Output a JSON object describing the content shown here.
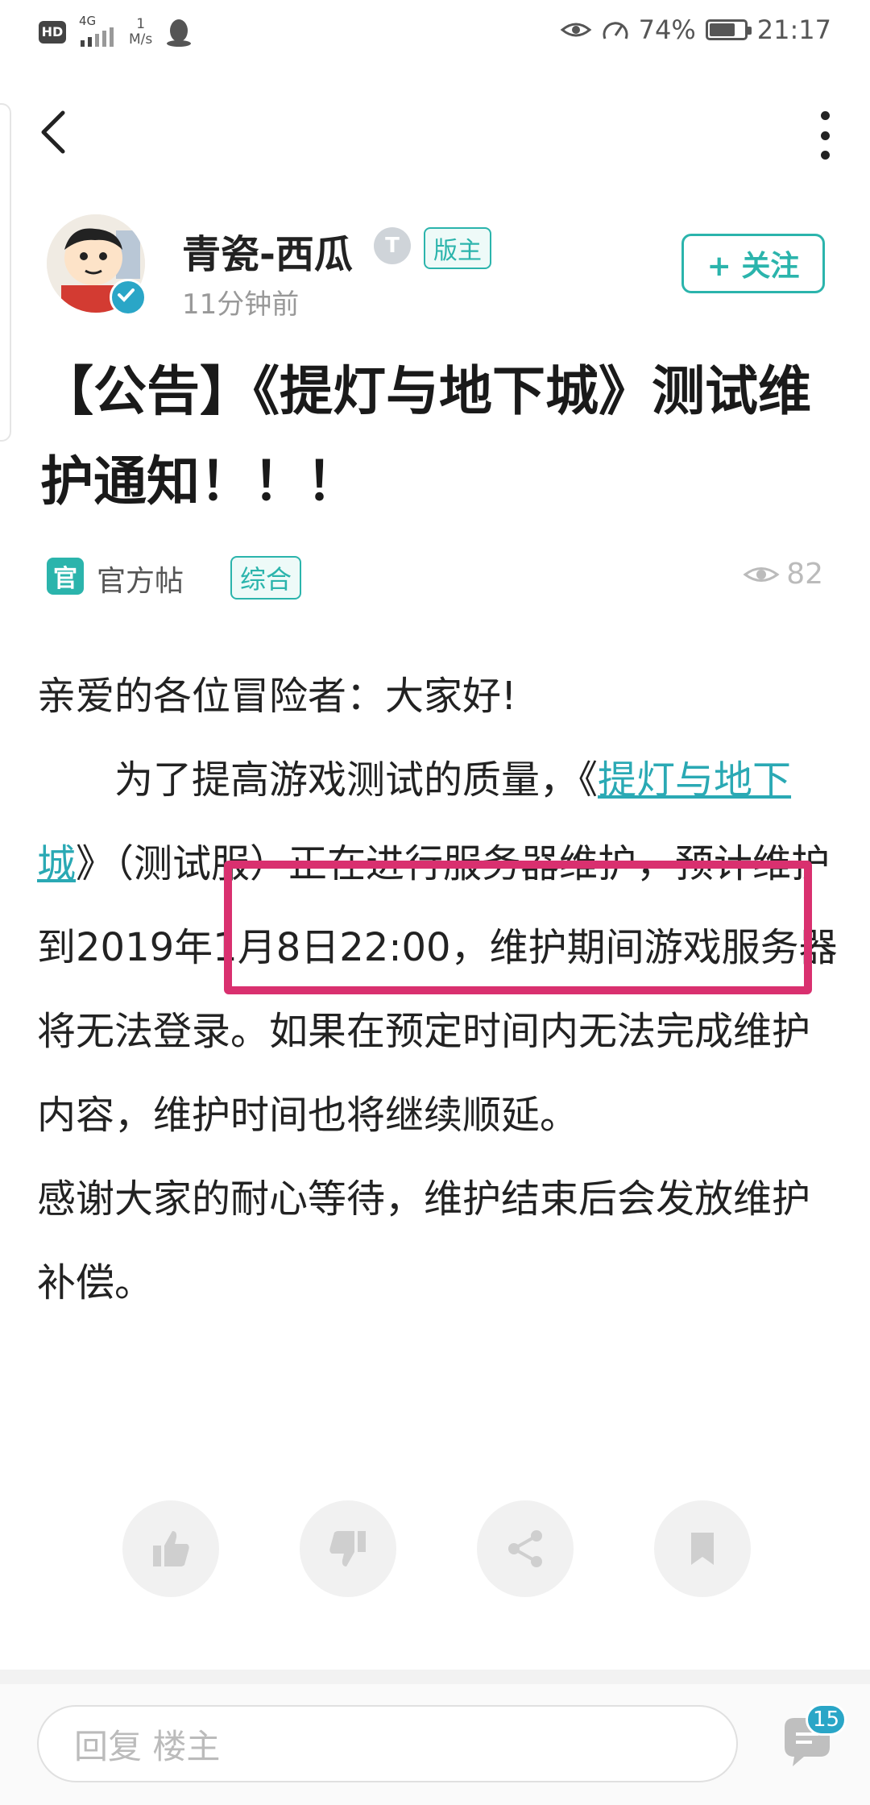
{
  "status_bar": {
    "hd": "HD",
    "network": "4G",
    "speed_value": "1",
    "speed_unit": "M/s",
    "battery_percent": "74%",
    "battery_level": 0.74,
    "time": "21:17"
  },
  "author": {
    "name": "青瓷-西瓜",
    "level_badge": "T",
    "role_badge": "版主",
    "time": "11分钟前",
    "follow_label": "+ 关注"
  },
  "post": {
    "title": "【公告】《提灯与地下城》测试维护通知！！！",
    "official_icon": "官",
    "official_label": "官方帖",
    "category": "综合",
    "views": "82",
    "body": {
      "p1": "亲爱的各位冒险者：大家好!",
      "p2_pre": "为了提高游戏测试的质量，《",
      "p2_link": "提灯与地下城",
      "p2_post": "》（测试服）正在进行服务器维护，预计维护到2019年1月8日22:00，维护期间游戏服务器将无法登录。如果在预定时间内无法完成维护内容，维护时间也将继续顺延。",
      "p3": "感谢大家的耐心等待，维护结束后会发放维护补偿。"
    }
  },
  "actions": {
    "icons": [
      "thumbs-up-icon",
      "thumbs-down-icon",
      "share-icon",
      "bookmark-icon"
    ]
  },
  "bottom": {
    "reply_placeholder": "回复  楼主",
    "comment_count": "15"
  },
  "colors": {
    "accent": "#2bb4ac",
    "highlight": "#d9306f"
  }
}
